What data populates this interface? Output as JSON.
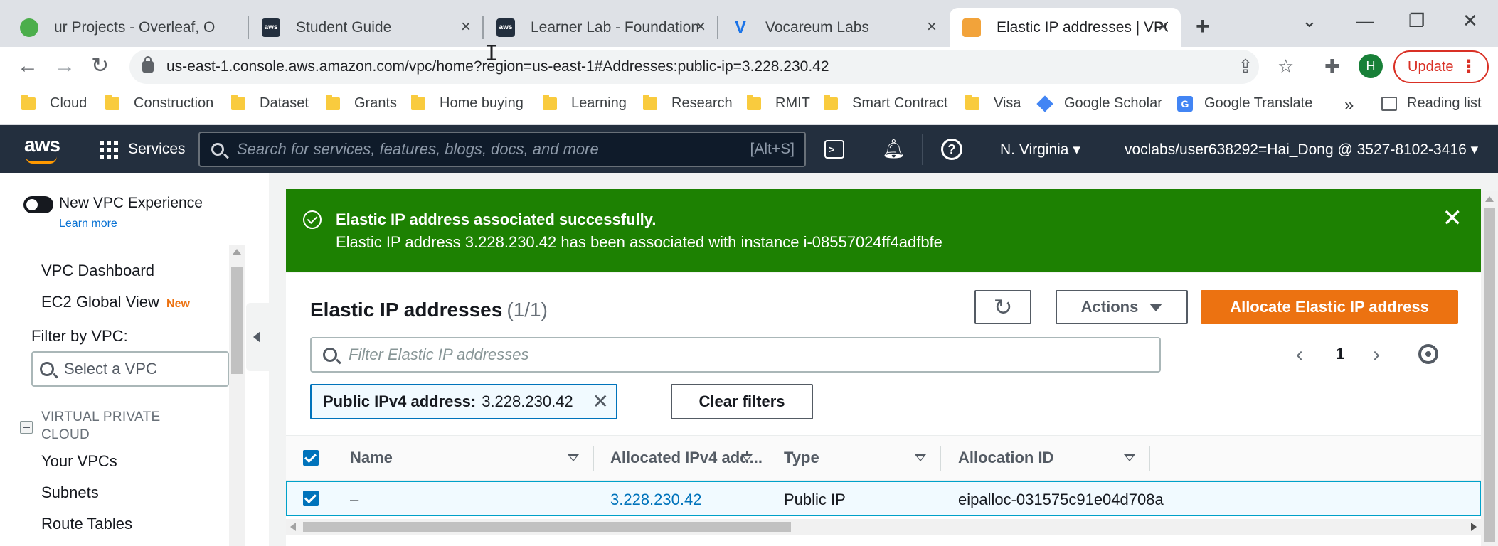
{
  "browser": {
    "tabs": [
      {
        "title": "ur Projects - Overleaf, O",
        "icon": "overleaf-icon"
      },
      {
        "title": "Student Guide",
        "icon": "aws-icon"
      },
      {
        "title": "Learner Lab - Foundation",
        "icon": "aws-icon"
      },
      {
        "title": "Vocareum Labs",
        "icon": "vocareum-icon"
      },
      {
        "title": "Elastic IP addresses | VPC",
        "icon": "aws-box-icon"
      }
    ],
    "url": "us-east-1.console.aws.amazon.com/vpc/home?region=us-east-1#Addresses:public-ip=3.228.230.42",
    "profile_initial": "H",
    "update_label": "Update",
    "bookmarks": [
      "Cloud",
      "Construction",
      "Dataset",
      "Grants",
      "Home buying",
      "Learning",
      "Research",
      "RMIT",
      "Smart Contract",
      "Visa",
      "Google Scholar",
      "Google Translate"
    ],
    "overflow_label": "»",
    "reading_list": "Reading list"
  },
  "aws_nav": {
    "logo": "aws",
    "services": "Services",
    "search_placeholder": "Search for services, features, blogs, docs, and more",
    "search_shortcut": "[Alt+S]",
    "region": "N. Virginia",
    "account": "voclabs/user638292=Hai_Dong @ 3527-8102-3416"
  },
  "sidebar": {
    "new_experience": "New VPC Experience",
    "learn_more": "Learn more",
    "items": [
      "VPC Dashboard",
      "EC2 Global View"
    ],
    "new_badge": "New",
    "filter_label": "Filter by VPC:",
    "select_placeholder": "Select a VPC",
    "section": "VIRTUAL PRIVATE CLOUD",
    "section_items": [
      "Your VPCs",
      "Subnets",
      "Route Tables"
    ]
  },
  "flash": {
    "header": "Elastic IP address associated successfully.",
    "message": "Elastic IP address 3.228.230.42 has been associated with instance i-08557024ff4adfbfe"
  },
  "table_card": {
    "title": "Elastic IP addresses",
    "count": "(1/1)",
    "actions_label": "Actions",
    "allocate_label": "Allocate Elastic IP address",
    "filter_placeholder": "Filter Elastic IP addresses",
    "page": "1",
    "token_key": "Public IPv4 address:",
    "token_value": "3.228.230.42",
    "clear_filters": "Clear filters",
    "columns": [
      "Name",
      "Allocated IPv4 add...",
      "Type",
      "Allocation ID"
    ],
    "rows": [
      {
        "name": "–",
        "ip": "3.228.230.42",
        "type": "Public IP",
        "allocation_id": "eipalloc-031575c91e04d708a",
        "selected": true
      }
    ]
  },
  "colors": {
    "aws_nav_bg": "#232f3e",
    "success_green": "#1d8102",
    "primary_orange": "#ec7211",
    "link_blue": "#0073bb"
  }
}
